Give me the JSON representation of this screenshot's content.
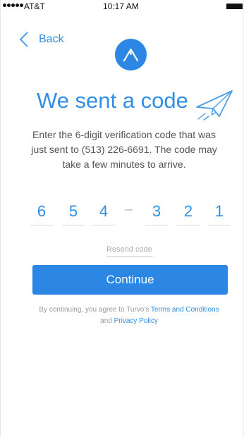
{
  "status_bar": {
    "carrier": "AT&T",
    "time": "10:17 AM"
  },
  "nav": {
    "back_label": "Back"
  },
  "header": {
    "title": "We sent a code",
    "subtitle": "Enter the 6-digit verification code that was just sent to (513) 226-6691.  The code may take a few minutes to arrive."
  },
  "code": {
    "digits": [
      "6",
      "5",
      "4",
      "3",
      "2",
      "1"
    ],
    "separator": "–"
  },
  "actions": {
    "resend_label": "Resend code",
    "continue_label": "Continue"
  },
  "legal": {
    "prefix": "By continuing, you agree to Turvo's ",
    "terms_link": "Terms and Conditions",
    "and_text": "and ",
    "privacy_link": "Privacy Policy"
  },
  "colors": {
    "accent": "#2f8fe6",
    "button": "#2b87e3"
  },
  "icons": {
    "back": "chevron-left-icon",
    "logo": "turvo-logo-icon",
    "plane": "paper-plane-icon"
  }
}
